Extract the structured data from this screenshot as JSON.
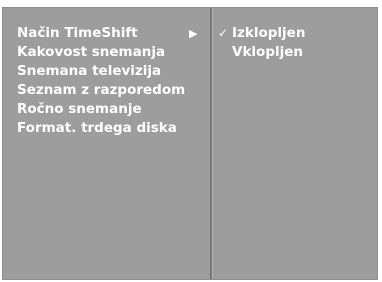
{
  "menu": {
    "items": [
      {
        "label": "Način TimeShift",
        "arrow": "▶"
      },
      {
        "label": "Kakovost snemanja"
      },
      {
        "label": "Snemana televizija"
      },
      {
        "label": "Seznam z razporedom"
      },
      {
        "label": "Ročno snemanje"
      },
      {
        "label": "Format. trdega diska"
      }
    ]
  },
  "submenu": {
    "check_glyph": "✓",
    "options": [
      {
        "label": "Izklopljen",
        "selected": true
      },
      {
        "label": "Vklopljen",
        "selected": false
      }
    ]
  },
  "colors": {
    "panel_bg": "#9d9d9d",
    "text": "#ffffff",
    "divider": "#777777"
  }
}
